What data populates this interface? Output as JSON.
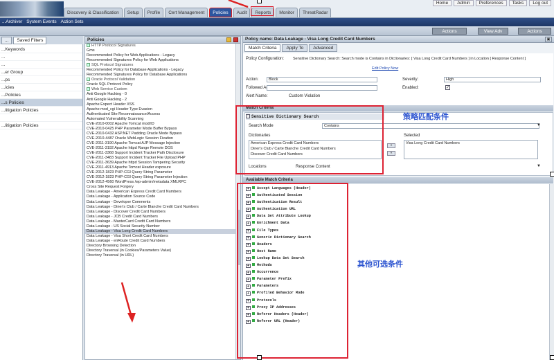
{
  "top": {
    "tabs": [
      "Discovery & Classification",
      "Setup",
      "Profile",
      "Cert Management",
      "Policies",
      "Audit",
      "Reports",
      "Monitor",
      "ThreatRadar"
    ],
    "active_tab": 4,
    "links": [
      "Home",
      "Admin",
      "Preferences",
      "Tasks",
      "Log out"
    ]
  },
  "secbar": {
    "links": [
      "...Archiver",
      "System Events",
      "Action Sets"
    ]
  },
  "toolbar": {
    "buttons": [
      "Actions",
      "View Adv",
      "Actions"
    ]
  },
  "left": {
    "tabs": [
      "...",
      "Saved Filters"
    ],
    "items": [
      "...Keywords",
      "...",
      "...",
      "...er Group",
      "...ps",
      "...icies",
      "...Policies",
      "...s Policies",
      "...litigation Policies",
      "",
      "...litigation Policies"
    ],
    "selected_index": 7
  },
  "middle": {
    "header": "Policies",
    "items": [
      {
        "t": "HTTP Protocol Signatures",
        "g": true
      },
      {
        "t": "Gms",
        "g": false
      },
      {
        "t": "Recommended Policy for Web Applications - Legacy",
        "g": false
      },
      {
        "t": "Recommended Signatures Policy for Web Applications",
        "g": false
      },
      {
        "t": "SQL Protocol Signatures",
        "g": true
      },
      {
        "t": "Recommended Policy for Database Applications - Legacy",
        "g": false
      },
      {
        "t": "Recommended Signatures Policy for Database Applications",
        "g": false
      },
      {
        "t": "Oracle Protocol Validation",
        "g": true
      },
      {
        "t": "Oracle SQL Protocol Policy",
        "g": false
      },
      {
        "t": "Web Service Custom",
        "g": true
      },
      {
        "t": "Anti Google Hacking - 0",
        "g": false
      },
      {
        "t": "Anti Google Hacking - 2",
        "g": false
      },
      {
        "t": "Apache Expect Header XSS",
        "g": false
      },
      {
        "t": "Apache mod_cgi Header Type Evasion",
        "g": false
      },
      {
        "t": "Authenticated Site Reconnaissance/Access",
        "g": false
      },
      {
        "t": "Automated Vulnerability Scanning",
        "g": false
      },
      {
        "t": "CVE-2010-0002 Apache Tomcat mod/ID",
        "g": false
      },
      {
        "t": "CVE-2010-0425 PHP Parameter Mode Buffer Bypass",
        "g": false
      },
      {
        "t": "CVE-2010-0432 ASP.NET Padding Oracle Mode Bypass",
        "g": false
      },
      {
        "t": "CVE-2010-4487 Oracle WebLogic Session Fixation",
        "g": false
      },
      {
        "t": "CVE-2011-3190 Apache Tomcat AJP Message Injection",
        "g": false
      },
      {
        "t": "CVE-2011-3192 Apache httpd Range Remote DOS",
        "g": false
      },
      {
        "t": "CVE-2011-3368 Support Incident Tracker Path Disclosure",
        "g": false
      },
      {
        "t": "CVE-2011-3483 Support Incident Tracker File Upload PHP",
        "g": false
      },
      {
        "t": "CVE-2011-3639 Apache httpd Session Tampering Security",
        "g": false
      },
      {
        "t": "CVE-2011-4913 Apache Tomcat Header exposure",
        "g": false
      },
      {
        "t": "CVE-2012-1823 PHP-CGI Query String Parameter",
        "g": false
      },
      {
        "t": "CVE-2012-1823 PHP-CGI Query String Parameter Injection",
        "g": false
      },
      {
        "t": "CVE-2012-4560 WordPress /wp-admin/metadata XMLRPC",
        "g": false
      },
      {
        "t": "Cross Site Request Forgery",
        "g": false
      },
      {
        "t": "Data Leakage - American Express Credit Card Numbers",
        "g": false
      },
      {
        "t": "Data Leakage - Application Source Code",
        "g": false
      },
      {
        "t": "Data Leakage - Developer Comments",
        "g": false
      },
      {
        "t": "Data Leakage - Diner's Club / Carte Blanche Credit Card Numbers",
        "g": false
      },
      {
        "t": "Data Leakage - Discover Credit Card Numbers",
        "g": false
      },
      {
        "t": "Data Leakage - JCB Credit Card Numbers",
        "g": false
      },
      {
        "t": "Data Leakage - MasterCard Credit Card Numbers",
        "g": false
      },
      {
        "t": "Data Leakage - US Social Security Number",
        "g": false
      },
      {
        "t": "Data Leakage - Visa Long Credit Card Numbers",
        "g": false
      },
      {
        "t": "Data Leakage - Visa Short Credit Card Numbers",
        "g": false
      },
      {
        "t": "Data Leakage - enRoute Credit Card Numbers",
        "g": false
      },
      {
        "t": "Directory Browsing Detection",
        "g": false
      },
      {
        "t": "Directory Traversal (in Cookies/Parameters Value)",
        "g": false
      },
      {
        "t": "Directory Traversal (in URL)",
        "g": false
      }
    ],
    "selected_index": 38
  },
  "right": {
    "header": "Policy name: Data Leakage - Visa Long Credit Card Numbers",
    "tabs": [
      "Match Criteria",
      "Apply To",
      "Advanced"
    ],
    "policy_config_label": "Policy Configuration:",
    "policy_config_value": "Sensitive Dictionary Search: Search mode is Contains in Dictionaries: [ Visa Long Credit Card Numbers ] in Location [ Response Content ]",
    "policy_config_link": "Edit Policy Now",
    "action_label": "Action:",
    "action_value": "Block",
    "followed_action_label": "Followed Action:",
    "alert_name_label": "Alert Name:",
    "alert_name_value": "Custom Violation",
    "severity_label": "Severity:",
    "severity_value": "High",
    "enabled_label": "Enabled:",
    "match_section": "Match Criteria",
    "dict_title": "Sensitive Dictionary Search",
    "search_mode_label": "Search Mode",
    "search_mode_value": "Contains",
    "dictionaries_label": "Dictionaries",
    "dict_list": [
      "American Express Credit Card Numbers",
      "Diner's Club / Carte Blanche Credit Card Numbers",
      "Discover Credit Card Numbers"
    ],
    "selected_label": "Selected",
    "selected_list": [
      "Visa Long Credit Card Numbers"
    ],
    "locations_label": "Locations",
    "locations_value": "Response Content",
    "available_section": "Available Match Criteria",
    "criteria": [
      "Accept Languages (Header)",
      "Authenticated Session",
      "Authentication Result",
      "Authentication URL",
      "Data Set Attribute Lookup",
      "Enrichment Data",
      "File Types",
      "Generic Dictionary Search",
      "Headers",
      "Host Name",
      "Lookup Data Set Search",
      "Methods",
      "Occurrence",
      "Parameter Prefix",
      "Parameters",
      "Profiled Behavior Mode",
      "Protocols",
      "Proxy IP Addresses",
      "Referer Headers (Header)",
      "Referer URL (Header)"
    ]
  },
  "annotations": {
    "match_label": "策略匹配条件",
    "other_label": "其他可选条件"
  },
  "colors": {
    "highlight": "#dd2233",
    "annotation": "#2c54d0",
    "nav": "#1e3765"
  }
}
